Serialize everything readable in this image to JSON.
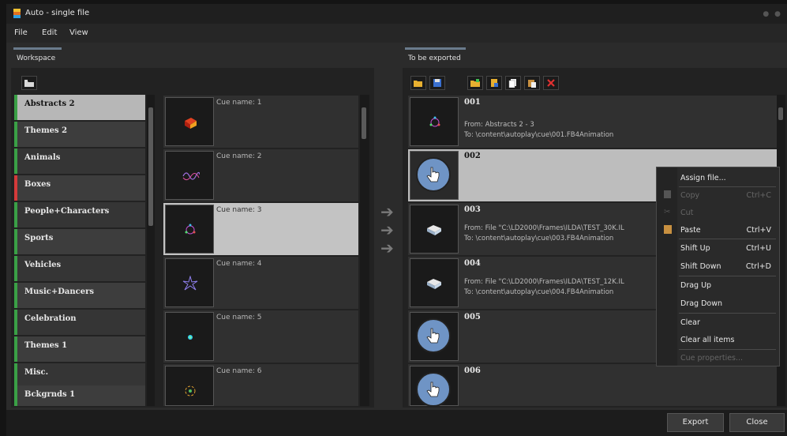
{
  "window": {
    "title": "Auto - single file"
  },
  "menu": [
    "File",
    "Edit",
    "View"
  ],
  "workspace": {
    "tab_label": "Workspace",
    "categories": [
      {
        "label": "Abstracts 2",
        "color": "#3aa046",
        "selected": true
      },
      {
        "label": "Themes 2",
        "color": "#3aa046"
      },
      {
        "label": "Animals",
        "color": "#3aa046"
      },
      {
        "label": "Boxes",
        "color": "#d43a3a"
      },
      {
        "label": "People+Characters",
        "color": "#3aa046"
      },
      {
        "label": "Sports",
        "color": "#3aa046"
      },
      {
        "label": "Vehicles",
        "color": "#3aa046"
      },
      {
        "label": "Music+Dancers",
        "color": "#3aa046"
      },
      {
        "label": "Celebration",
        "color": "#3aa046"
      },
      {
        "label": "Themes 1",
        "color": "#3aa046"
      },
      {
        "label": "Misc.",
        "color": "#3aa046"
      },
      {
        "label": "Bckgrnds 1",
        "color": "#3aa046"
      }
    ],
    "cues": [
      {
        "label": "Cue name: 1"
      },
      {
        "label": "Cue name: 2"
      },
      {
        "label": "Cue name: 3",
        "selected": true
      },
      {
        "label": "Cue name: 4"
      },
      {
        "label": "Cue name: 5"
      },
      {
        "label": "Cue name: 6"
      }
    ]
  },
  "export": {
    "tab_label": "To be exported",
    "items": [
      {
        "num": "001",
        "from": "From: Abstracts 2 - 3",
        "to": "To: \\content\\autoplay\\cue\\001.FB4Animation",
        "icon": "laser-frame-icon"
      },
      {
        "num": "002",
        "from": "",
        "to": "",
        "icon": "hand-cursor-icon",
        "selected": true
      },
      {
        "num": "003",
        "from": "From: File \"C:\\LD2000\\Frames\\ILDA\\TEST_30K.IL",
        "to": "To: \\content\\autoplay\\cue\\003.FB4Animation",
        "icon": "file-drive-icon"
      },
      {
        "num": "004",
        "from": "From: File \"C:\\LD2000\\Frames\\ILDA\\TEST_12K.IL",
        "to": "To: \\content\\autoplay\\cue\\004.FB4Animation",
        "icon": "file-drive-icon"
      },
      {
        "num": "005",
        "from": "",
        "to": "",
        "icon": "hand-cursor-icon"
      },
      {
        "num": "006",
        "from": "",
        "to": "",
        "icon": "hand-cursor-icon"
      }
    ]
  },
  "context_menu": {
    "assign_file": "Assign file...",
    "copy": "Copy",
    "copy_sc": "Ctrl+C",
    "cut": "Cut",
    "paste": "Paste",
    "paste_sc": "Ctrl+V",
    "shift_up": "Shift Up",
    "shift_up_sc": "Ctrl+U",
    "shift_down": "Shift Down",
    "shift_down_sc": "Ctrl+D",
    "drag_up": "Drag Up",
    "drag_down": "Drag Down",
    "clear": "Clear",
    "clear_all": "Clear all items",
    "cue_properties": "Cue properties..."
  },
  "buttons": {
    "export": "Export",
    "close": "Close"
  },
  "colors": {
    "accent_green": "#3aa046",
    "accent_red": "#d43a3a",
    "selection": "#b7b7b7",
    "hand_blue": "#6f94c5"
  }
}
